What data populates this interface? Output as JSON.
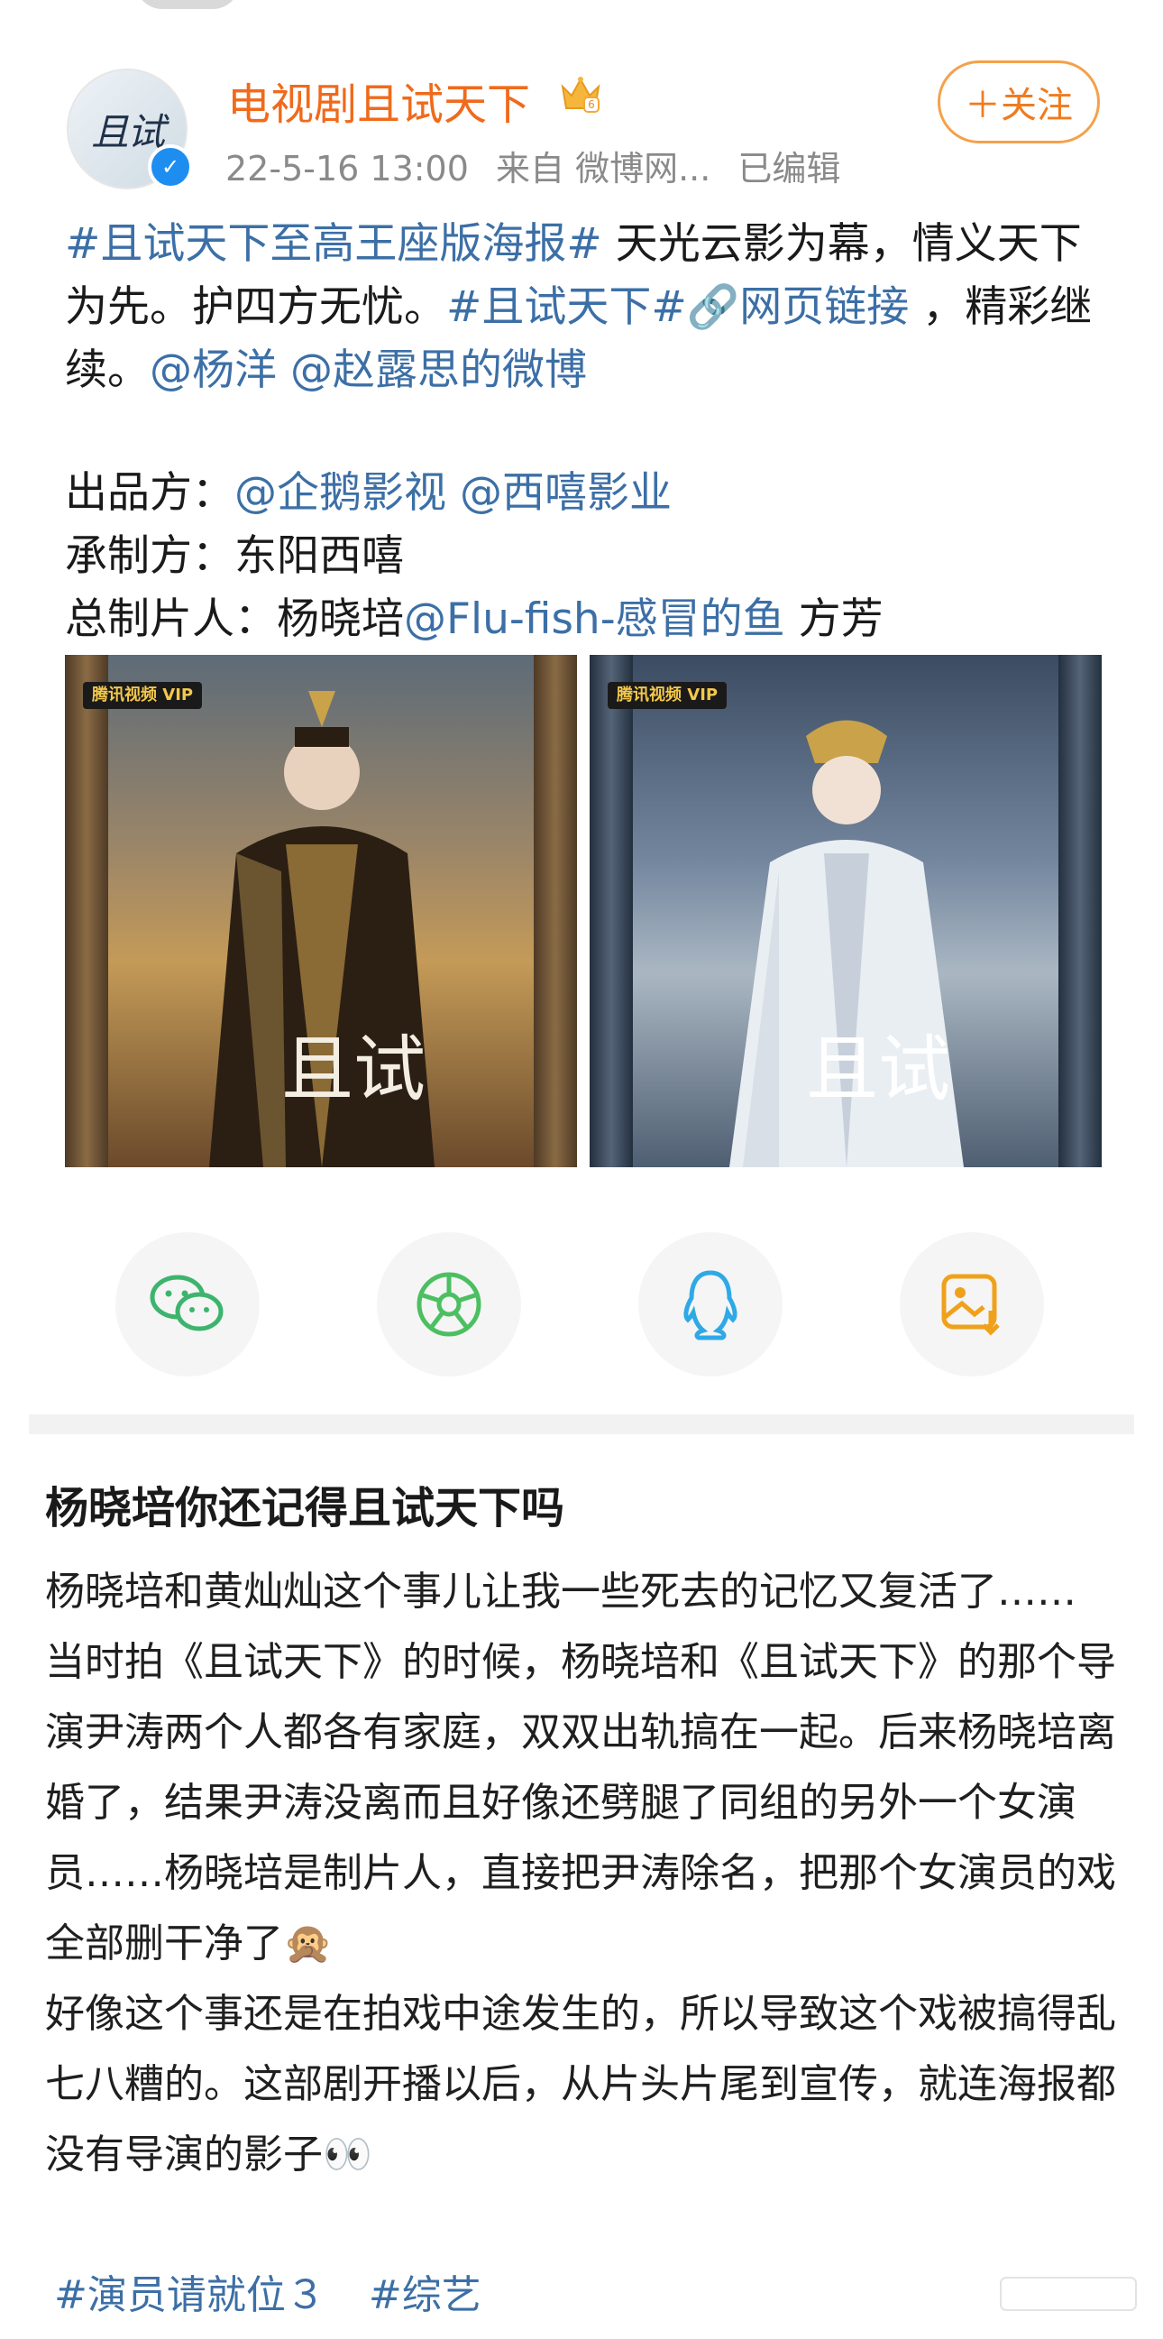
{
  "post": {
    "author": "电视剧且试天下",
    "timestamp": "22-5-16 13:00",
    "source": "来自 微博网...",
    "edited": "已编辑",
    "follow_label": "＋关注",
    "verified_icon": "verified-badge",
    "text_parts": [
      {
        "type": "link",
        "text": "#且试天下至高王座版海报#"
      },
      {
        "type": "text",
        "text": " 天光云影为幕，情义天下为先。护四方无忧。"
      },
      {
        "type": "link",
        "text": "#且试天下#"
      },
      {
        "type": "link",
        "text": "🔗网页链接"
      },
      {
        "type": "text",
        "text": " ，精彩继续。"
      },
      {
        "type": "link",
        "text": "@杨洋"
      },
      {
        "type": "text",
        "text": " "
      },
      {
        "type": "link",
        "text": "@赵露思的微博"
      }
    ],
    "credits": [
      {
        "label": "出品方：",
        "parts": [
          {
            "type": "link",
            "text": "@企鹅影视"
          },
          {
            "type": "text",
            "text": " "
          },
          {
            "type": "link",
            "text": "@西嘻影业"
          }
        ]
      },
      {
        "label": "承制方：",
        "parts": [
          {
            "type": "text",
            "text": "东阳西嘻"
          }
        ]
      },
      {
        "label": "总制片人：",
        "parts": [
          {
            "type": "text",
            "text": "杨晓培"
          },
          {
            "type": "link",
            "text": "@Flu-fish-感冒的鱼"
          },
          {
            "type": "text",
            "text": " 方芳"
          }
        ]
      }
    ],
    "posters": [
      {
        "badge": "腾讯视频 VIP",
        "title_glyphs": "且试"
      },
      {
        "badge": "腾讯视频 VIP",
        "title_glyphs": "且试"
      }
    ],
    "share_icons": [
      "wechat-icon",
      "moments-icon",
      "qq-icon",
      "save-image-icon"
    ]
  },
  "article": {
    "title": "杨晓培你还记得且试天下吗",
    "paragraphs": [
      "杨晓培和黄灿灿这个事儿让我一些死去的记忆又复活了……",
      "当时拍《且试天下》的时候，杨晓培和《且试天下》的那个导演尹涛两个人都各有家庭，双双出轨搞在一起。后来杨晓培离婚了，结果尹涛没离而且好像还劈腿了同组的另外一个女演员……杨晓培是制片人，直接把尹涛除名，把那个女演员的戏全部删干净了🙊",
      "好像这个事还是在拍戏中途发生的，所以导致这个戏被搞得乱七八糟的。这部剧开播以后，从片头片尾到宣传，就连海报都没有导演的影子👀"
    ],
    "tags": [
      "#演员请就位３",
      "#综艺"
    ]
  },
  "colors": {
    "accent_orange": "#f06a1b",
    "link_blue": "#3c6fa6",
    "meta_gray": "#8a8a8a"
  }
}
